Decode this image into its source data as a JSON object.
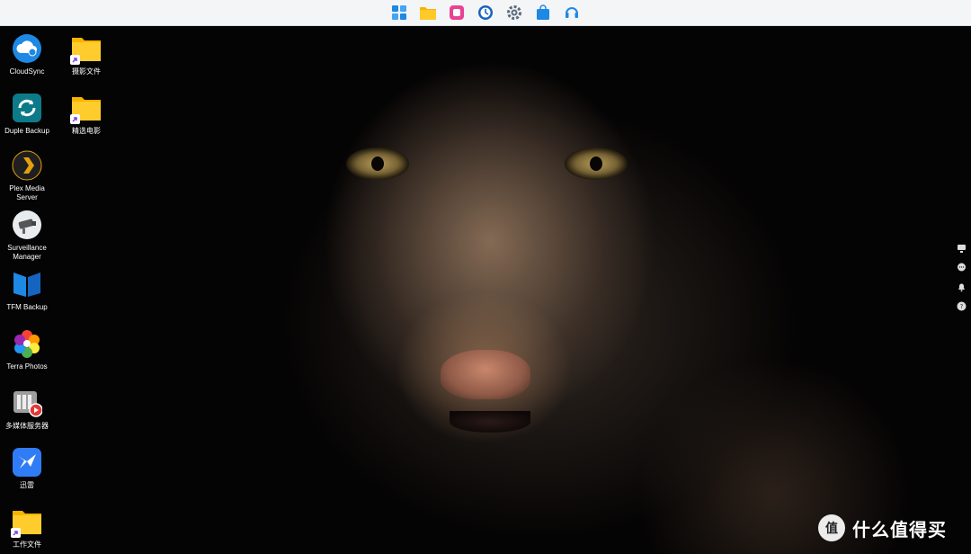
{
  "taskbar": {
    "icons": [
      {
        "name": "app-center-icon",
        "color": "#1e88e5"
      },
      {
        "name": "file-manager-icon",
        "color": "#f6b400"
      },
      {
        "name": "photos-app-icon",
        "color": "#e84393"
      },
      {
        "name": "backup-clock-icon",
        "color": "#1565c0"
      },
      {
        "name": "settings-gear-icon",
        "color": "#5a6b7c"
      },
      {
        "name": "app-store-bag-icon",
        "color": "#1e88e5"
      },
      {
        "name": "support-headset-icon",
        "color": "#1e88e5"
      }
    ]
  },
  "desktop": {
    "column1": [
      {
        "label": "CloudSync",
        "icon": "cloudsync-icon"
      },
      {
        "label": "Duple Backup",
        "icon": "duple-backup-icon"
      },
      {
        "label": "Plex Media Server",
        "icon": "plex-icon"
      },
      {
        "label": "Surveillance Manager",
        "icon": "surveillance-camera-icon"
      },
      {
        "label": "TFM Backup",
        "icon": "tfm-backup-icon"
      },
      {
        "label": "Terra Photos",
        "icon": "terra-photos-icon"
      },
      {
        "label": "多媒体服务器",
        "icon": "media-server-icon"
      },
      {
        "label": "迅雷",
        "icon": "xunlei-icon"
      },
      {
        "label": "工作文件",
        "icon": "folder-shortcut-icon"
      }
    ],
    "column2": [
      {
        "label": "摄影文件",
        "icon": "folder-shortcut-icon"
      },
      {
        "label": "精选电影",
        "icon": "folder-shortcut-icon"
      }
    ]
  },
  "side_icons": [
    "monitor-icon",
    "chat-icon",
    "bell-icon",
    "help-icon"
  ],
  "watermark": {
    "logo": "值",
    "text": "什么值得买"
  }
}
